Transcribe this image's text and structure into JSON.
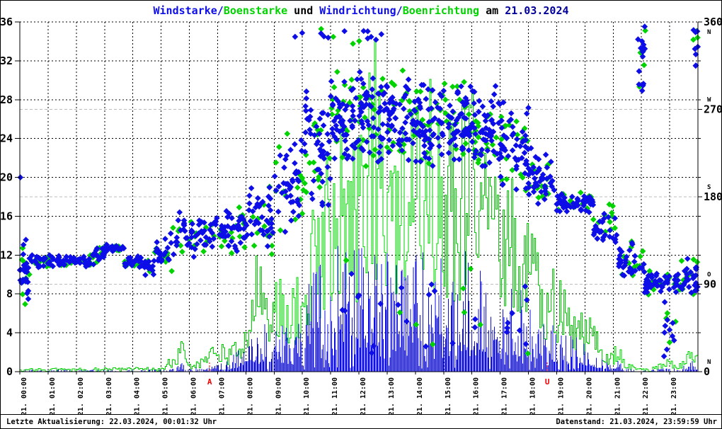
{
  "title": {
    "windstarke": "Windstarke",
    "sep1": "/",
    "boenstarke": "Boenstarke",
    "und": " und ",
    "windrichtung": "Windrichtung",
    "sep2": "/",
    "boenrichtung": "Boenrichtung",
    "am": " am ",
    "date": "21.03.2024"
  },
  "footer": {
    "left": "Letzte Aktualisierung: 22.03.2024, 00:01:32 Uhr",
    "right": "Datenstand: 21.03.2024, 23:59:59 Uhr"
  },
  "colors": {
    "wind_blue": "#0d0de8",
    "gust_green": "#00d300",
    "date_navy": "#000099",
    "quadrant_gray": "#bdbdbd",
    "sun_red": "#ee0000",
    "grid_black": "#000000",
    "background": "#ffffff"
  },
  "chart_data": {
    "type": "scatter",
    "title": "Windstarke/Boenstarke und Windrichtung/Boenrichtung am 21.03.2024",
    "x_axis": {
      "hours": 24,
      "labels": [
        "21. 00:00",
        "21. 01:00",
        "21. 02:00",
        "21. 03:00",
        "21. 04:00",
        "21. 05:00",
        "21. 06:00",
        "21. 07:00",
        "21. 08:00",
        "21. 09:00",
        "21. 10:00",
        "21. 11:00",
        "21. 12:00",
        "21. 13:00",
        "21. 14:00",
        "21. 15:00",
        "21. 16:00",
        "21. 17:00",
        "21. 18:00",
        "21. 19:00",
        "21. 20:00",
        "21. 21:00",
        "21. 22:00",
        "21. 23:00"
      ]
    },
    "y_left": {
      "range": [
        0,
        36
      ],
      "ticks": [
        0,
        4,
        8,
        12,
        16,
        20,
        24,
        28,
        32,
        36
      ]
    },
    "y_right": {
      "range": [
        0,
        360
      ],
      "minor_tick_step_deg": 40,
      "labels": [
        {
          "deg": 0,
          "text": "0",
          "letter": "N",
          "letter_side": "above"
        },
        {
          "deg": 90,
          "text": "90",
          "letter": "O",
          "letter_side": "above"
        },
        {
          "deg": 180,
          "text": "180",
          "letter": "S",
          "letter_side": "above"
        },
        {
          "deg": 270,
          "text": "270",
          "letter": "W",
          "letter_side": "above"
        },
        {
          "deg": 360,
          "text": "360",
          "letter": "N",
          "letter_side": "below"
        }
      ],
      "quadrant_gridlines_deg": [
        90,
        180,
        270
      ]
    },
    "sun_markers": [
      {
        "label": "A",
        "hour": 6.72
      },
      {
        "label": "U",
        "hour": 18.67
      }
    ],
    "series": [
      {
        "name": "Windrichtung",
        "kind": "direction-scatter",
        "marker": "diamond",
        "color": "wind_blue",
        "axis": "right",
        "segments_t0_t1_meandeg_spreaddeg_n": [
          [
            0.0,
            0.35,
            105,
            38,
            26
          ],
          [
            0.35,
            2.6,
            114,
            7,
            62
          ],
          [
            2.6,
            3.0,
            120,
            10,
            15
          ],
          [
            3.0,
            3.7,
            127,
            5,
            25
          ],
          [
            3.7,
            4.35,
            114,
            7,
            20
          ],
          [
            4.35,
            4.75,
            106,
            10,
            14
          ],
          [
            4.75,
            5.3,
            122,
            18,
            18
          ],
          [
            5.3,
            6.3,
            135,
            30,
            30
          ],
          [
            6.3,
            7.3,
            143,
            22,
            35
          ],
          [
            7.3,
            8.1,
            150,
            28,
            30
          ],
          [
            8.1,
            9.0,
            158,
            40,
            35
          ],
          [
            9.0,
            10.0,
            195,
            65,
            40
          ],
          [
            10.0,
            11.0,
            230,
            70,
            45
          ],
          [
            11.0,
            12.0,
            262,
            55,
            55
          ],
          [
            12.0,
            13.0,
            268,
            55,
            55
          ],
          [
            13.0,
            14.0,
            260,
            50,
            55
          ],
          [
            14.0,
            15.0,
            255,
            48,
            55
          ],
          [
            15.0,
            16.0,
            258,
            46,
            55
          ],
          [
            16.0,
            17.0,
            250,
            46,
            55
          ],
          [
            17.0,
            18.0,
            235,
            55,
            50
          ],
          [
            18.0,
            19.0,
            200,
            32,
            40
          ],
          [
            19.0,
            20.3,
            173,
            11,
            52
          ],
          [
            20.3,
            21.2,
            150,
            23,
            30
          ],
          [
            21.2,
            22.1,
            112,
            23,
            30
          ],
          [
            21.85,
            22.15,
            320,
            42,
            14
          ],
          [
            22.1,
            23.4,
            92,
            13,
            45
          ],
          [
            22.8,
            23.25,
            45,
            40,
            10
          ],
          [
            23.4,
            24.0,
            95,
            25,
            25
          ],
          [
            23.8,
            24.0,
            332,
            30,
            8
          ],
          [
            9.2,
            12.8,
            345,
            15,
            12
          ],
          [
            11.0,
            18.0,
            60,
            55,
            26
          ]
        ],
        "outliers_t_deg": [
          [
            0.02,
            200
          ]
        ]
      },
      {
        "name": "Boenrichtung",
        "kind": "direction-scatter",
        "marker": "diamond",
        "color": "gust_green",
        "axis": "right",
        "derived_from": "Windrichtung"
      },
      {
        "name": "Windstarke",
        "kind": "speed-impulse",
        "color": "wind_blue",
        "axis": "left"
      },
      {
        "name": "Boenstarke",
        "kind": "speed-step",
        "color": "gust_green",
        "axis": "left"
      }
    ],
    "speed_envelope_t_wind_gust": [
      [
        0.0,
        0.15,
        0.3
      ],
      [
        5.0,
        0.15,
        0.4
      ],
      [
        5.55,
        0.3,
        2.0
      ],
      [
        5.75,
        0.8,
        3.6
      ],
      [
        5.95,
        0.2,
        0.6
      ],
      [
        6.5,
        0.4,
        1.5
      ],
      [
        6.95,
        0.5,
        2.8
      ],
      [
        7.3,
        0.8,
        2.2
      ],
      [
        7.7,
        1.5,
        3.2
      ],
      [
        8.2,
        3.0,
        8.0
      ],
      [
        8.5,
        5.0,
        15.0
      ],
      [
        8.8,
        2.5,
        7.0
      ],
      [
        9.3,
        3.5,
        10.0
      ],
      [
        9.7,
        2.5,
        8.0
      ],
      [
        10.2,
        6.5,
        16.0
      ],
      [
        10.7,
        8.0,
        18.0
      ],
      [
        11.2,
        9.0,
        24.0
      ],
      [
        11.7,
        8.5,
        22.0
      ],
      [
        12.2,
        9.5,
        26.0
      ],
      [
        12.55,
        10.5,
        31.5
      ],
      [
        12.9,
        9.0,
        24.0
      ],
      [
        13.4,
        8.0,
        21.0
      ],
      [
        13.9,
        9.0,
        25.0
      ],
      [
        14.4,
        8.5,
        26.0
      ],
      [
        14.9,
        9.0,
        27.0
      ],
      [
        15.4,
        8.0,
        23.0
      ],
      [
        15.9,
        9.0,
        26.0
      ],
      [
        16.4,
        8.0,
        24.0
      ],
      [
        16.9,
        7.5,
        21.0
      ],
      [
        17.4,
        6.5,
        18.0
      ],
      [
        17.9,
        5.5,
        14.0
      ],
      [
        18.4,
        4.5,
        11.0
      ],
      [
        18.9,
        3.5,
        9.0
      ],
      [
        19.4,
        3.0,
        7.5
      ],
      [
        19.9,
        2.5,
        6.0
      ],
      [
        20.4,
        1.5,
        4.0
      ],
      [
        20.9,
        0.5,
        2.0
      ],
      [
        21.15,
        0.8,
        2.6
      ],
      [
        21.45,
        0.3,
        1.0
      ],
      [
        21.8,
        0.1,
        0.3
      ],
      [
        22.3,
        0.1,
        0.3
      ],
      [
        22.9,
        0.3,
        1.2
      ],
      [
        23.3,
        0.2,
        0.8
      ],
      [
        23.8,
        0.8,
        2.3
      ],
      [
        24.0,
        0.5,
        1.8
      ]
    ],
    "synthesis": {
      "seed": 20240321,
      "impulse_step_hours": 0.033333,
      "gust_step_hours": 0.05,
      "gust_point_fraction": 0.35,
      "gust_spread_scale": 1.15
    }
  }
}
